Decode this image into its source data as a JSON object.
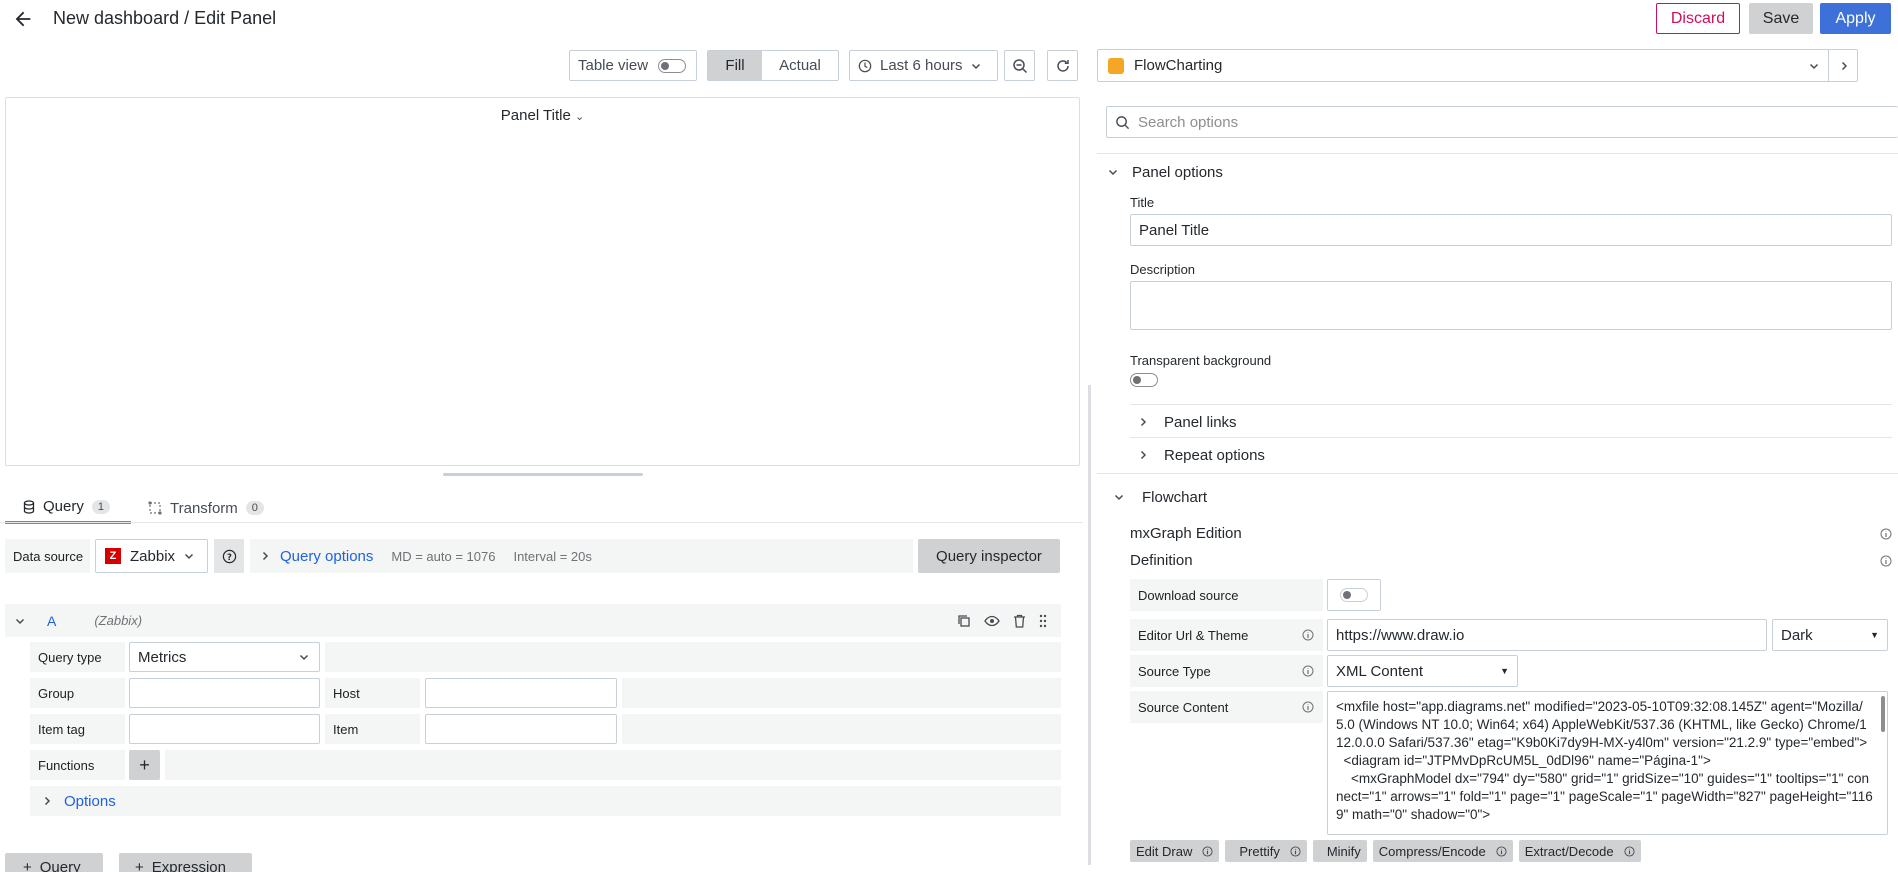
{
  "header": {
    "title": "New dashboard / Edit Panel",
    "discard": "Discard",
    "save": "Save",
    "apply": "Apply"
  },
  "toolbar": {
    "table_view": "Table view",
    "fill": "Fill",
    "actual": "Actual",
    "time_range": "Last 6 hours"
  },
  "visualization": {
    "name": "FlowCharting"
  },
  "panel": {
    "title": "Panel Title"
  },
  "tabs": [
    {
      "label": "Query",
      "count": "1"
    },
    {
      "label": "Transform",
      "count": "0"
    }
  ],
  "datasource": {
    "label": "Data source",
    "name": "Zabbix",
    "logo": "Z",
    "query_options": "Query options",
    "md": "MD = auto = 1076",
    "interval": "Interval = 20s",
    "inspector": "Query inspector"
  },
  "query_row": {
    "ref": "A",
    "source": "(Zabbix)",
    "query_type_label": "Query type",
    "query_type_value": "Metrics",
    "group_label": "Group",
    "host_label": "Host",
    "item_tag_label": "Item tag",
    "item_label": "Item",
    "functions_label": "Functions",
    "functions_add": "+",
    "options_label": "Options"
  },
  "bottom_buttons": {
    "query": "Query",
    "expression": "Expression"
  },
  "options_pane": {
    "search_placeholder": "Search options",
    "panel_options": "Panel options",
    "title_label": "Title",
    "title_value": "Panel Title",
    "description_label": "Description",
    "transparent_label": "Transparent background",
    "panel_links": "Panel links",
    "repeat_options": "Repeat options",
    "flowchart": "Flowchart",
    "mxgraph_edition": "mxGraph Edition",
    "definition": "Definition",
    "download_source": "Download source",
    "editor_url_theme": "Editor Url & Theme",
    "editor_url": "https://www.draw.io",
    "theme": "Dark",
    "source_type_label": "Source Type",
    "source_type_value": "XML Content",
    "source_content_label": "Source Content",
    "source_content": "<mxfile host=\"app.diagrams.net\" modified=\"2023-05-10T09:32:08.145Z\" agent=\"Mozilla/5.0 (Windows NT 10.0; Win64; x64) AppleWebKit/537.36 (KHTML, like Gecko) Chrome/112.0.0.0 Safari/537.36\" etag=\"K9b0Ki7dy9H-MX-y4l0m\" version=\"21.2.9\" type=\"embed\">\n  <diagram id=\"JTPMvDpRcUM5L_0dDl96\" name=\"Página-1\">\n    <mxGraphModel dx=\"794\" dy=\"580\" grid=\"1\" gridSize=\"10\" guides=\"1\" tooltips=\"1\" connect=\"1\" arrows=\"1\" fold=\"1\" page=\"1\" pageScale=\"1\" pageWidth=\"827\" pageHeight=\"1169\" math=\"0\" shadow=\"0\">",
    "actions": [
      "Edit Draw",
      "Prettify",
      "Minify",
      "Compress/Encode",
      "Extract/Decode"
    ]
  },
  "colors": {
    "accent": "#3d71d9",
    "danger": "#d10e5c",
    "primary_btn": "#3d71d9",
    "tab_underline": "#f55f3e"
  }
}
